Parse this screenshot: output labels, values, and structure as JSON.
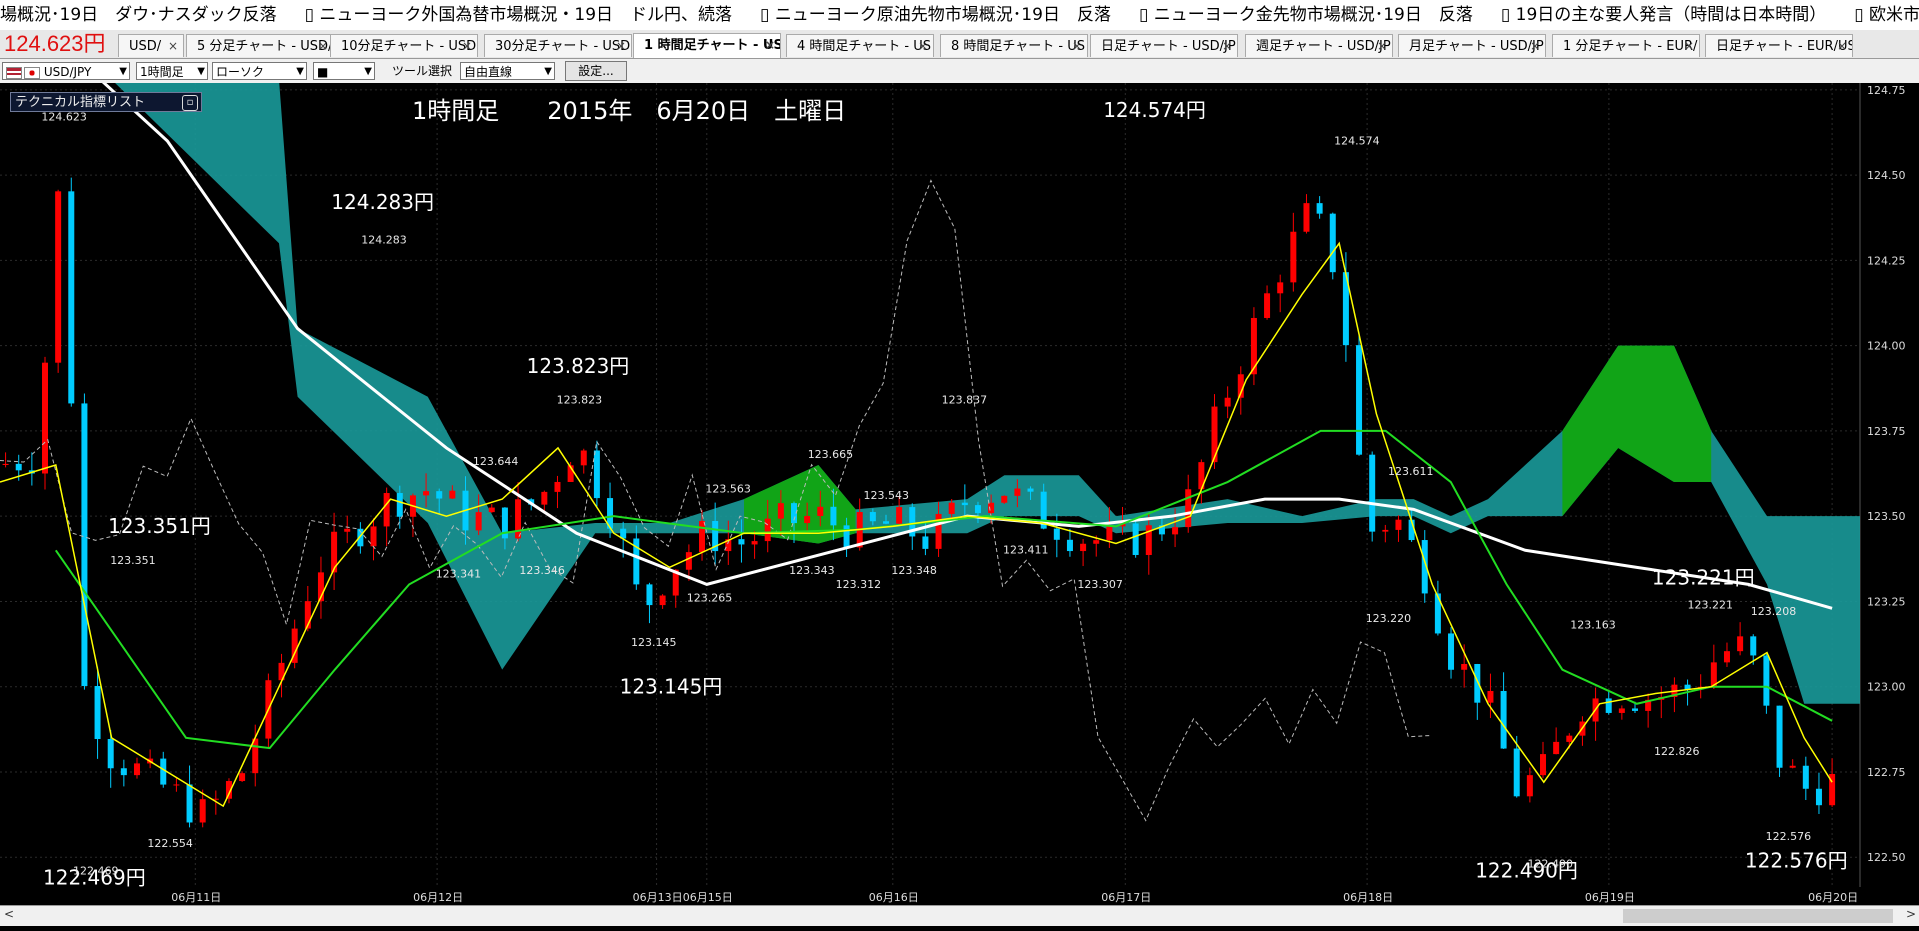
{
  "ticker": {
    "items": [
      {
        "prefix": "",
        "text": "場概況･19日　ダウ･ナスダック反落"
      },
      {
        "prefix": "",
        "text": "ニューヨーク外国為替市場概況・19日　ドル円、続落"
      },
      {
        "prefix": "",
        "text": "ニューヨーク原油先物市場概況･19日　反落"
      },
      {
        "prefix": "",
        "text": "ニューヨーク金先物市場概況･19日　反落"
      },
      {
        "prefix": "",
        "text": "19日の主な要人発言（時間は日本時間）"
      },
      {
        "prefix": "",
        "text": "欧米市"
      }
    ]
  },
  "price_overlay": "124.623円",
  "tabs": [
    {
      "label": "USD/",
      "active": false
    },
    {
      "label": "5 分足チャート - USD/",
      "active": false
    },
    {
      "label": "10分足チャート - USD,",
      "active": false
    },
    {
      "label": "30分足チャート - USD,",
      "active": false
    },
    {
      "label": "1 時間足チャート - US",
      "active": true
    },
    {
      "label": "4 時間足チャート - US",
      "active": false
    },
    {
      "label": "8 時間足チャート - US",
      "active": false
    },
    {
      "label": "日足チャート - USD/JP",
      "active": false
    },
    {
      "label": "週足チャート - USD/JP",
      "active": false
    },
    {
      "label": "月足チャート - USD/JP",
      "active": false
    },
    {
      "label": "1 分足チャート - EUR/",
      "active": false
    },
    {
      "label": "日足チャート - EUR/US",
      "active": false
    }
  ],
  "toolbar": {
    "pair": "USD/JPY",
    "timeframe": "1時間足",
    "chart_type": "ローソク",
    "color": "■",
    "tool_label": "ツール選択",
    "tool_value": "自由直線",
    "settings": "設定..."
  },
  "panel": {
    "title": "テクニカル指標リスト"
  },
  "colors": {
    "up": "#ff0000",
    "down": "#00ccff",
    "cloud_teal": "#1a9a9a",
    "cloud_green": "#11a511",
    "sma_long": "#ffffff",
    "ma_mid": "#22dd22",
    "ma_fast": "#ffff00"
  },
  "chart_data": {
    "type": "candlestick",
    "title": "1時間足　　2015年　6月20日　土曜日",
    "y_axis": {
      "ticks": [
        "124.75",
        "124.50",
        "124.25",
        "124.00",
        "123.75",
        "123.50",
        "123.25",
        "123.00",
        "122.75",
        "122.50"
      ],
      "range": [
        122.36,
        124.77
      ]
    },
    "x_axis": {
      "ticks": [
        "06月11日",
        "06月12日",
        "06月13日",
        "06月15日",
        "06月16日",
        "06月17日",
        "06月18日",
        "06月19日",
        "06月20日"
      ]
    },
    "x_positions": [
      0.105,
      0.235,
      0.353,
      0.38,
      0.48,
      0.605,
      0.735,
      0.865,
      0.985
    ],
    "big_labels": [
      {
        "text": "124.574円",
        "x": 0.62,
        "v": 124.67
      },
      {
        "text": "124.283円",
        "x": 0.205,
        "v": 124.4
      },
      {
        "text": "123.823円",
        "x": 0.31,
        "v": 123.92
      },
      {
        "text": "123.351円",
        "x": 0.085,
        "v": 123.45
      },
      {
        "text": "123.221円",
        "x": 0.915,
        "v": 123.3
      },
      {
        "text": "123.145円",
        "x": 0.36,
        "v": 122.98
      },
      {
        "text": "122.469円",
        "x": 0.05,
        "v": 122.42
      },
      {
        "text": "122.490円",
        "x": 0.82,
        "v": 122.44
      },
      {
        "text": "122.576円",
        "x": 0.965,
        "v": 122.47
      }
    ],
    "small_labels": [
      {
        "text": "124.623",
        "x": 0.033,
        "v": 124.66
      },
      {
        "text": "124.283",
        "x": 0.205,
        "v": 124.3
      },
      {
        "text": "123.823",
        "x": 0.31,
        "v": 123.83
      },
      {
        "text": "123.837",
        "x": 0.517,
        "v": 123.83
      },
      {
        "text": "124.574",
        "x": 0.728,
        "v": 124.59
      },
      {
        "text": "123.644",
        "x": 0.265,
        "v": 123.65
      },
      {
        "text": "123.665",
        "x": 0.445,
        "v": 123.67
      },
      {
        "text": "123.563",
        "x": 0.39,
        "v": 123.57
      },
      {
        "text": "123.543",
        "x": 0.475,
        "v": 123.55
      },
      {
        "text": "123.611",
        "x": 0.757,
        "v": 123.62
      },
      {
        "text": "123.351",
        "x": 0.07,
        "v": 123.36
      },
      {
        "text": "123.341",
        "x": 0.245,
        "v": 123.32
      },
      {
        "text": "123.346",
        "x": 0.29,
        "v": 123.33
      },
      {
        "text": "123.343",
        "x": 0.435,
        "v": 123.33
      },
      {
        "text": "123.312",
        "x": 0.46,
        "v": 123.29
      },
      {
        "text": "123.348",
        "x": 0.49,
        "v": 123.33
      },
      {
        "text": "123.411",
        "x": 0.55,
        "v": 123.39
      },
      {
        "text": "123.307",
        "x": 0.59,
        "v": 123.29
      },
      {
        "text": "123.265",
        "x": 0.38,
        "v": 123.25
      },
      {
        "text": "123.145",
        "x": 0.35,
        "v": 123.12
      },
      {
        "text": "123.220",
        "x": 0.745,
        "v": 123.19
      },
      {
        "text": "123.163",
        "x": 0.855,
        "v": 123.17
      },
      {
        "text": "123.221",
        "x": 0.918,
        "v": 123.23
      },
      {
        "text": "123.208",
        "x": 0.952,
        "v": 123.21
      },
      {
        "text": "122.826",
        "x": 0.9,
        "v": 122.8
      },
      {
        "text": "122.554",
        "x": 0.09,
        "v": 122.53
      },
      {
        "text": "122.469",
        "x": 0.05,
        "v": 122.45
      },
      {
        "text": "122.490",
        "x": 0.832,
        "v": 122.47
      },
      {
        "text": "122.576",
        "x": 0.96,
        "v": 122.55
      }
    ],
    "candle_anchors": [
      [
        0.0,
        123.65
      ],
      [
        0.02,
        123.68
      ],
      [
        0.033,
        124.55
      ],
      [
        0.045,
        123.0
      ],
      [
        0.06,
        122.8
      ],
      [
        0.09,
        122.7
      ],
      [
        0.11,
        122.62
      ],
      [
        0.13,
        122.75
      ],
      [
        0.15,
        123.05
      ],
      [
        0.17,
        123.35
      ],
      [
        0.19,
        123.45
      ],
      [
        0.21,
        123.55
      ],
      [
        0.23,
        123.58
      ],
      [
        0.25,
        123.5
      ],
      [
        0.27,
        123.48
      ],
      [
        0.29,
        123.55
      ],
      [
        0.31,
        123.72
      ],
      [
        0.33,
        123.5
      ],
      [
        0.345,
        123.22
      ],
      [
        0.36,
        123.35
      ],
      [
        0.38,
        123.45
      ],
      [
        0.4,
        123.42
      ],
      [
        0.42,
        123.48
      ],
      [
        0.44,
        123.5
      ],
      [
        0.46,
        123.45
      ],
      [
        0.48,
        123.48
      ],
      [
        0.5,
        123.43
      ],
      [
        0.52,
        123.55
      ],
      [
        0.54,
        123.58
      ],
      [
        0.56,
        123.5
      ],
      [
        0.58,
        123.44
      ],
      [
        0.6,
        123.42
      ],
      [
        0.62,
        123.45
      ],
      [
        0.64,
        123.55
      ],
      [
        0.655,
        123.8
      ],
      [
        0.67,
        124.0
      ],
      [
        0.69,
        124.25
      ],
      [
        0.705,
        124.4
      ],
      [
        0.72,
        124.2
      ],
      [
        0.735,
        123.45
      ],
      [
        0.75,
        123.5
      ],
      [
        0.765,
        123.35
      ],
      [
        0.78,
        123.1
      ],
      [
        0.8,
        122.95
      ],
      [
        0.815,
        122.7
      ],
      [
        0.83,
        122.75
      ],
      [
        0.85,
        122.95
      ],
      [
        0.87,
        122.98
      ],
      [
        0.89,
        122.97
      ],
      [
        0.91,
        123.0
      ],
      [
        0.925,
        123.1
      ],
      [
        0.94,
        123.12
      ],
      [
        0.955,
        122.8
      ],
      [
        0.97,
        122.7
      ],
      [
        0.985,
        122.72
      ]
    ],
    "series": [
      {
        "name": "",
        "style": "white-thick",
        "points": [
          [
            0.03,
            124.9
          ],
          [
            0.09,
            124.6
          ],
          [
            0.16,
            124.05
          ],
          [
            0.24,
            123.7
          ],
          [
            0.31,
            123.45
          ],
          [
            0.38,
            123.3
          ],
          [
            0.45,
            123.4
          ],
          [
            0.52,
            123.5
          ],
          [
            0.58,
            123.47
          ],
          [
            0.63,
            123.5
          ],
          [
            0.68,
            123.55
          ],
          [
            0.72,
            123.55
          ],
          [
            0.76,
            123.52
          ],
          [
            0.82,
            123.4
          ],
          [
            0.88,
            123.35
          ],
          [
            0.94,
            123.3
          ],
          [
            0.985,
            123.23
          ]
        ]
      },
      {
        "name": "",
        "style": "green",
        "points": [
          [
            0.03,
            123.4
          ],
          [
            0.1,
            122.85
          ],
          [
            0.145,
            122.82
          ],
          [
            0.18,
            123.05
          ],
          [
            0.22,
            123.3
          ],
          [
            0.27,
            123.45
          ],
          [
            0.33,
            123.5
          ],
          [
            0.4,
            123.45
          ],
          [
            0.46,
            123.46
          ],
          [
            0.53,
            123.5
          ],
          [
            0.6,
            123.47
          ],
          [
            0.66,
            123.6
          ],
          [
            0.71,
            123.75
          ],
          [
            0.745,
            123.75
          ],
          [
            0.78,
            123.6
          ],
          [
            0.81,
            123.3
          ],
          [
            0.84,
            123.05
          ],
          [
            0.88,
            122.95
          ],
          [
            0.92,
            123.0
          ],
          [
            0.95,
            123.0
          ],
          [
            0.985,
            122.9
          ]
        ]
      },
      {
        "name": "",
        "style": "yellow",
        "points": [
          [
            0.0,
            123.6
          ],
          [
            0.03,
            123.65
          ],
          [
            0.06,
            122.85
          ],
          [
            0.09,
            122.75
          ],
          [
            0.12,
            122.65
          ],
          [
            0.15,
            123.0
          ],
          [
            0.18,
            123.35
          ],
          [
            0.21,
            123.55
          ],
          [
            0.24,
            123.5
          ],
          [
            0.27,
            123.55
          ],
          [
            0.3,
            123.7
          ],
          [
            0.33,
            123.45
          ],
          [
            0.36,
            123.35
          ],
          [
            0.4,
            123.45
          ],
          [
            0.44,
            123.45
          ],
          [
            0.48,
            123.47
          ],
          [
            0.52,
            123.5
          ],
          [
            0.56,
            123.48
          ],
          [
            0.6,
            123.42
          ],
          [
            0.64,
            123.5
          ],
          [
            0.67,
            123.9
          ],
          [
            0.7,
            124.15
          ],
          [
            0.72,
            124.3
          ],
          [
            0.74,
            123.8
          ],
          [
            0.77,
            123.3
          ],
          [
            0.8,
            122.95
          ],
          [
            0.83,
            122.72
          ],
          [
            0.86,
            122.95
          ],
          [
            0.89,
            122.98
          ],
          [
            0.92,
            123.0
          ],
          [
            0.95,
            123.1
          ],
          [
            0.97,
            122.85
          ],
          [
            0.985,
            122.72
          ]
        ]
      }
    ],
    "cloud": [
      [
        0.06,
        124.78,
        124.78
      ],
      [
        0.15,
        124.78,
        124.3
      ],
      [
        0.16,
        124.05,
        123.85
      ],
      [
        0.23,
        123.85,
        123.48
      ],
      [
        0.27,
        123.45,
        123.05
      ],
      [
        0.32,
        123.48,
        123.45
      ],
      [
        0.36,
        123.48,
        123.45
      ],
      [
        0.4,
        123.55,
        123.45
      ],
      [
        0.44,
        123.65,
        123.42
      ],
      [
        0.46,
        123.52,
        123.45
      ],
      [
        0.52,
        123.55,
        123.45
      ],
      [
        0.54,
        123.62,
        123.5
      ],
      [
        0.58,
        123.62,
        123.5
      ],
      [
        0.6,
        123.5,
        123.45
      ],
      [
        0.66,
        123.55,
        123.48
      ],
      [
        0.7,
        123.5,
        123.48
      ],
      [
        0.74,
        123.55,
        123.5
      ],
      [
        0.76,
        123.55,
        123.5
      ],
      [
        0.78,
        123.5,
        123.45
      ],
      [
        0.8,
        123.55,
        123.5
      ],
      [
        0.84,
        123.75,
        123.5
      ],
      [
        0.87,
        124.0,
        123.7
      ],
      [
        0.9,
        124.0,
        123.6
      ],
      [
        0.92,
        123.75,
        123.6
      ],
      [
        0.95,
        123.5,
        123.3
      ],
      [
        0.97,
        123.5,
        122.95
      ],
      [
        1.0,
        123.5,
        122.95
      ]
    ]
  }
}
